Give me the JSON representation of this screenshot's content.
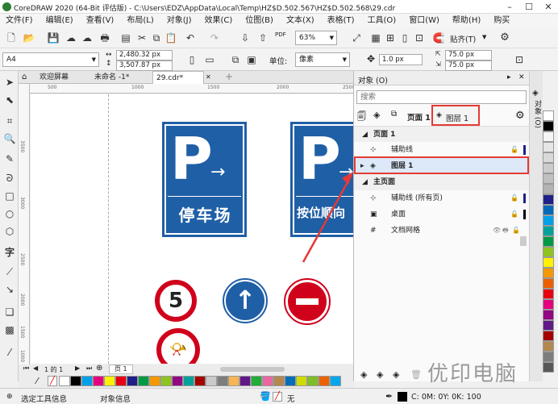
{
  "window": {
    "title": "CoreDRAW 2020 (64-Bit 评估版) - C:\\Users\\EDZ\\AppData\\Local\\Temp\\HZ$D.502.567\\HZ$D.502.568\\29.cdr"
  },
  "menu": [
    "文件(F)",
    "编辑(E)",
    "查看(V)",
    "布局(L)",
    "对象(J)",
    "效果(C)",
    "位图(B)",
    "文本(X)",
    "表格(T)",
    "工具(O)",
    "窗口(W)",
    "帮助(H)",
    "购买"
  ],
  "toolbar": {
    "zoom": "63%",
    "snap_label": "贴齐(T)",
    "pdf_label": "PDF"
  },
  "propbar": {
    "page_size": "A4",
    "width": "2,480.32 px",
    "height": "3,507.87 px",
    "unit_label": "单位:",
    "unit": "像素",
    "nudge": "1.0 px",
    "dup_x": "75.0 px",
    "dup_y": "75.0 px"
  },
  "tabs": [
    {
      "label": "欢迎屏幕"
    },
    {
      "label": "未命名 -1*"
    },
    {
      "label": "29.cdr*"
    }
  ],
  "ruler": {
    "h": [
      "500",
      "1000",
      "1500",
      "2000",
      "2500"
    ],
    "v": [
      "3500",
      "3000",
      "2500",
      "2000",
      "1500",
      "1000"
    ]
  },
  "canvas": {
    "parking_text": "停车场",
    "parking_text2": "按位顺向",
    "speed_limit": "5"
  },
  "page_nav": {
    "position": "1 的 1",
    "page_tab": "页 1"
  },
  "objects_panel": {
    "title": "对象 (O)",
    "search_placeholder": "搜索",
    "page_label": "页面 1",
    "layer_label": "图层 1",
    "rows": [
      {
        "label": "页面 1"
      },
      {
        "label": "辅助线"
      },
      {
        "label": "图层 1"
      },
      {
        "label": "主页面"
      },
      {
        "label": "辅助线 (所有页)"
      },
      {
        "label": "桌面"
      },
      {
        "label": "文档网格"
      }
    ]
  },
  "dock": {
    "label": "对象 (O)"
  },
  "status": {
    "tool_info": "选定工具信息",
    "object_info": "对象信息",
    "fill": "无",
    "cmyk": "C: 0M: 0Y: 0K: 100"
  },
  "watermark": "优印电脑",
  "colors": {
    "sign_blue": "#1f5fa6",
    "sign_red": "#d0021b",
    "annotation_red": "#e53935",
    "selection_blue": "#dde8f8"
  }
}
